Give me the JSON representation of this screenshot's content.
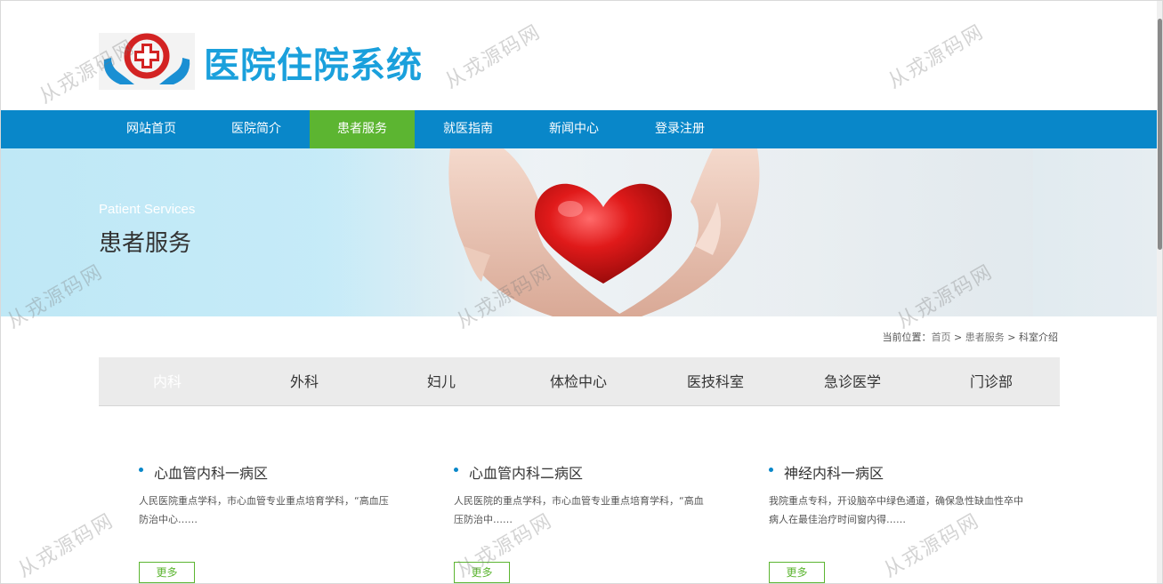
{
  "header": {
    "title": "医院住院系统",
    "logo_icon": "hospital-cross-hands-icon",
    "brand_color": "#1aa0dc"
  },
  "nav": {
    "items": [
      "网站首页",
      "医院简介",
      "患者服务",
      "就医指南",
      "新闻中心",
      "登录注册"
    ],
    "active": "患者服务",
    "bg_color": "#0987c9",
    "active_color": "#5cb531"
  },
  "banner": {
    "subtitle_en": "Patient Services",
    "title_cn": "患者服务",
    "image": "hands-holding-red-heart"
  },
  "breadcrumb": {
    "prefix": "当前位置：",
    "home": "首页",
    "sep1": " > ",
    "section": "患者服务",
    "sep2": " > ",
    "current": "科室介绍"
  },
  "tabs": {
    "items": [
      "内科",
      "外科",
      "妇儿",
      "体检中心",
      "医技科室",
      "急诊医学",
      "门诊部"
    ],
    "active": "内科"
  },
  "cards": [
    {
      "title": "心血管内科一病区",
      "desc": "人民医院重点学科，市心血管专业重点培育学科，“高血压防治中心……",
      "more": "更多"
    },
    {
      "title": "心血管内科二病区",
      "desc": "人民医院的重点学科，市心血管专业重点培育学科，“高血压防治中……",
      "more": "更多"
    },
    {
      "title": "神经内科一病区",
      "desc": "我院重点专科，开设脑卒中绿色通道，确保急性缺血性卒中病人在最佳治疗时间窗内得……",
      "more": "更多"
    }
  ],
  "watermark": "从戎源码网"
}
